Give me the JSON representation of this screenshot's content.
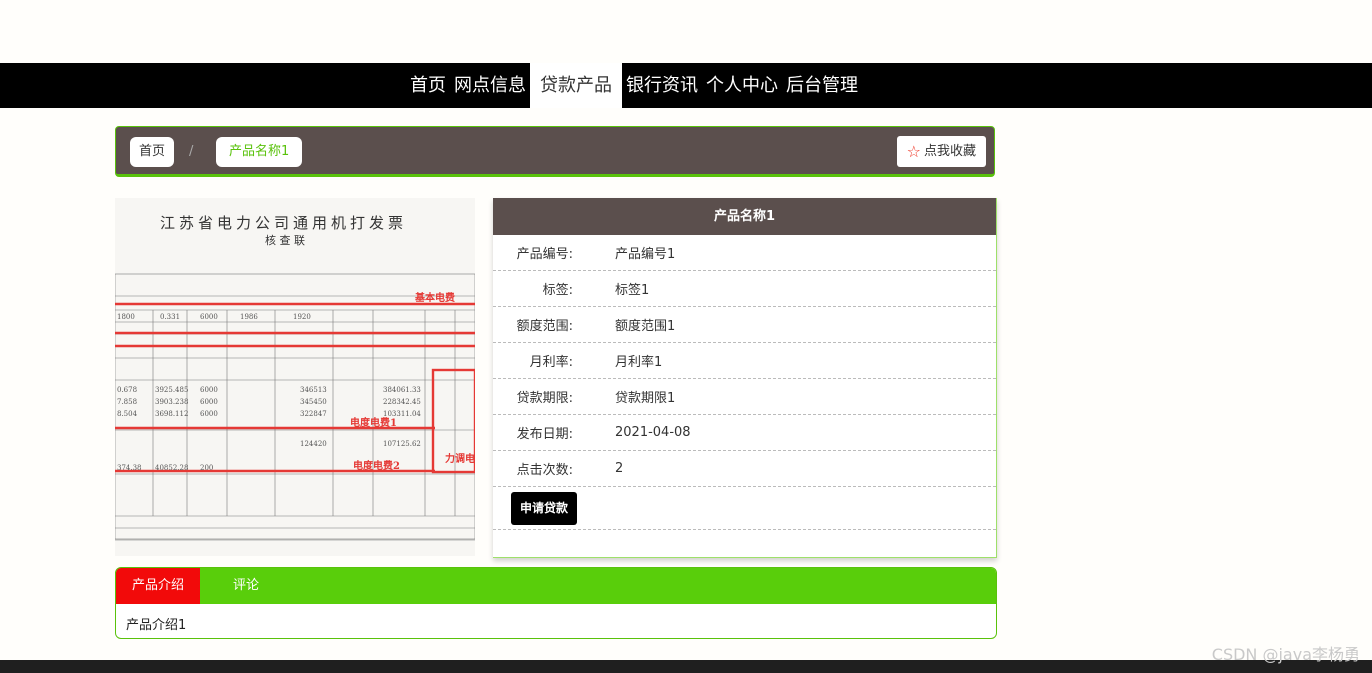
{
  "nav": {
    "items": [
      {
        "label": "首页",
        "active": false
      },
      {
        "label": "网点信息",
        "active": false
      },
      {
        "label": "贷款产品",
        "active": true
      },
      {
        "label": "银行资讯",
        "active": false
      },
      {
        "label": "个人中心",
        "active": false
      },
      {
        "label": "后台管理",
        "active": false
      }
    ]
  },
  "breadcrumb": {
    "home": "首页",
    "separator": "/",
    "current": "产品名称1",
    "favorite_label": "点我收藏",
    "favorite_icon": "star-outline-icon"
  },
  "image": {
    "invoice_title": "江苏省电力公司通用机打发票",
    "invoice_subtitle": "核 查 联",
    "annotations": [
      "基本电费",
      "电度电费1",
      "电度电费2",
      "力调电"
    ]
  },
  "detail": {
    "title": "产品名称1",
    "rows": [
      {
        "label": "产品编号:",
        "value": "产品编号1"
      },
      {
        "label": "标签:",
        "value": "标签1"
      },
      {
        "label": "额度范围:",
        "value": "额度范围1"
      },
      {
        "label": "月利率:",
        "value": "月利率1"
      },
      {
        "label": "贷款期限:",
        "value": "贷款期限1"
      },
      {
        "label": "发布日期:",
        "value": "2021-04-08"
      },
      {
        "label": "点击次数:",
        "value": "2"
      }
    ],
    "apply_label": "申请贷款"
  },
  "tabs": {
    "items": [
      {
        "label": "产品介绍",
        "active": true
      },
      {
        "label": "评论",
        "active": false
      }
    ],
    "content": "产品介绍1"
  },
  "watermark": "CSDN @java李杨勇",
  "colors": {
    "nav_bg": "#000000",
    "panel_brown": "#5b4f4d",
    "accent_green": "#59ce0b",
    "tab_active_red": "#f20a0a"
  }
}
